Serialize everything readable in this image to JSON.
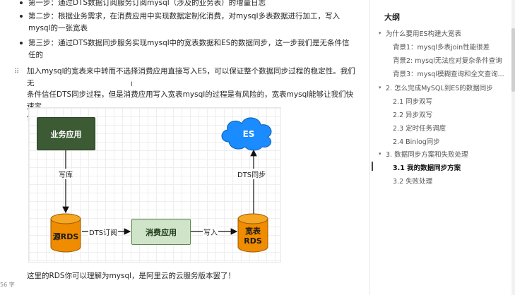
{
  "doc": {
    "steps": [
      {
        "label": "第一步：",
        "text": "通过DTS数据订阅服务订阅mysql（涉及的业务表）的增量日志"
      },
      {
        "label": "第二步：",
        "text": "根据业务需求，在消费应用中实现数据定制化消费，对mysql多表数据进行加工，写入"
      },
      {
        "label": "",
        "text": "mysql的一张宽表"
      },
      {
        "label": "第三步：",
        "text": "通过DTS数据同步服务实现mysql中的宽表数据和ES的数据同步，这一步我们是无条件信"
      },
      {
        "label": "",
        "text": "任的"
      }
    ],
    "paragraph_lines": [
      "加入mysql的宽表来中转而不选择消费应用直接写入ES，可以保证整个数据同步过程的稳定性。我们无",
      "条件信任DTS同步过程，但是消费应用写入宽表mysql的过程是有风险的，宽表mysql能够让我们快速定",
      "位错误。"
    ],
    "bottom_text": "这里的RDS你可以理解为mysql，是阿里云的云服务版本罢了！",
    "word_count": "56 字"
  },
  "diagram": {
    "nodes": {
      "biz_app": "业务应用",
      "es": "ES",
      "source_rds": "源RDS",
      "consume_app": "消费应用",
      "wide_table_line1": "宽表",
      "wide_table_line2": "RDS"
    },
    "edges": {
      "write_db": "写库",
      "dts_subscribe": "DTS订阅",
      "write_in": "写入",
      "dts_sync": "DTS同步"
    },
    "colors": {
      "biz_app": "#3c5a34",
      "consume_app": "#cfe4c9",
      "rds": "#f08c00",
      "es": "#1a8cff"
    }
  },
  "toc": {
    "title": "大纲",
    "items": [
      {
        "text": "为什么要用ES构建大宽表",
        "level": 1,
        "caret": "▾"
      },
      {
        "text": "背景1：mysql多表join性能很差",
        "level": 2
      },
      {
        "text": "背景2: mysql无法应对复杂条件查询",
        "level": 2
      },
      {
        "text": "背景3：mysql模糊查询和全文查询...",
        "level": 2
      },
      {
        "text": "2. 怎么完成MySQL到ES的数据同步",
        "level": 1,
        "caret": "▾"
      },
      {
        "text": "2.1 同步双写",
        "level": 2
      },
      {
        "text": "2.2 异步双写",
        "level": 2
      },
      {
        "text": "2.3 定时任务调度",
        "level": 2
      },
      {
        "text": "2.4 Binlog同步",
        "level": 2
      },
      {
        "text": "3. 数据同步方案和失败处理",
        "level": 1,
        "caret": "▾"
      },
      {
        "text": "3.1 我的数据同步方案",
        "level": 2,
        "active": true
      },
      {
        "text": "3.2 失败处理",
        "level": 2
      }
    ]
  }
}
